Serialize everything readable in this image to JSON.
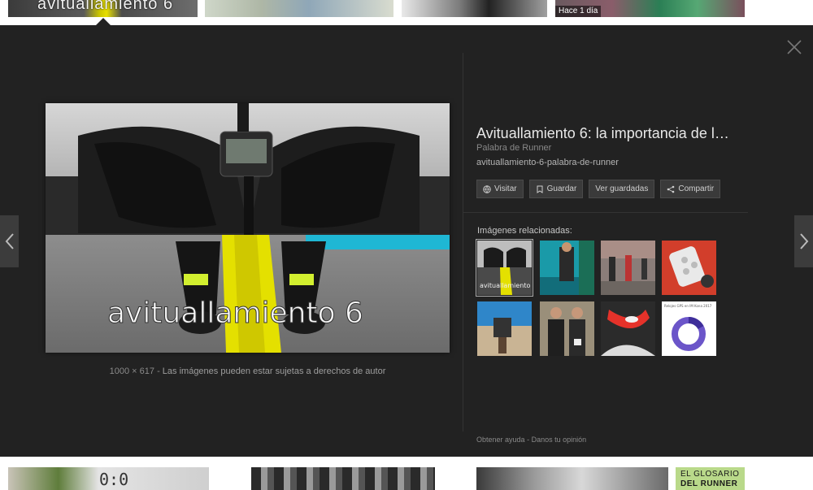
{
  "top_results": {
    "thumb1_overlay": "avituallamiento 6",
    "thumb4_badge": "Hace 1 día"
  },
  "viewer": {
    "close_icon": "close-icon",
    "prev_icon": "chevron-left-icon",
    "next_icon": "chevron-right-icon",
    "image_overlay_text": "avituallamiento 6",
    "image_dimensions": "1000 × 617",
    "separator": "-",
    "copyright_notice": "Las imágenes pueden estar sujetas a derechos de autor"
  },
  "info": {
    "title": "Avituallamiento 6: la importancia de l…",
    "source": "Palabra de Runner",
    "url": "avituallamiento-6-palabra-de-runner",
    "actions": [
      {
        "label": "Visitar",
        "icon": "globe-icon"
      },
      {
        "label": "Guardar",
        "icon": "bookmark-icon"
      },
      {
        "label": "Ver guardadas",
        "icon": ""
      },
      {
        "label": "Compartir",
        "icon": "share-icon"
      }
    ]
  },
  "related": {
    "label": "Imágenes relacionadas:",
    "items": [
      {
        "name": "related-1",
        "caption": "avituallamiento",
        "selected": true
      },
      {
        "name": "related-2",
        "caption": ""
      },
      {
        "name": "related-3",
        "caption": ""
      },
      {
        "name": "related-4",
        "caption": ""
      },
      {
        "name": "related-5",
        "caption": ""
      },
      {
        "name": "related-6",
        "caption": ""
      },
      {
        "name": "related-7",
        "caption": ""
      },
      {
        "name": "related-8",
        "caption": "Relojes GPS en IM Kona 2017"
      }
    ]
  },
  "footer": {
    "help": "Obtener ayuda",
    "separator": "-",
    "feedback": "Danos tu opinión"
  },
  "bottom_results": {
    "thumb4_line1": "EL GLOSARIO",
    "thumb4_line2": "DEL RUNNER",
    "clock_text": "0:0"
  },
  "colors": {
    "panel_bg": "#222222",
    "button_bg": "#3a3a3a",
    "accent_yellow": "#e4e000"
  }
}
